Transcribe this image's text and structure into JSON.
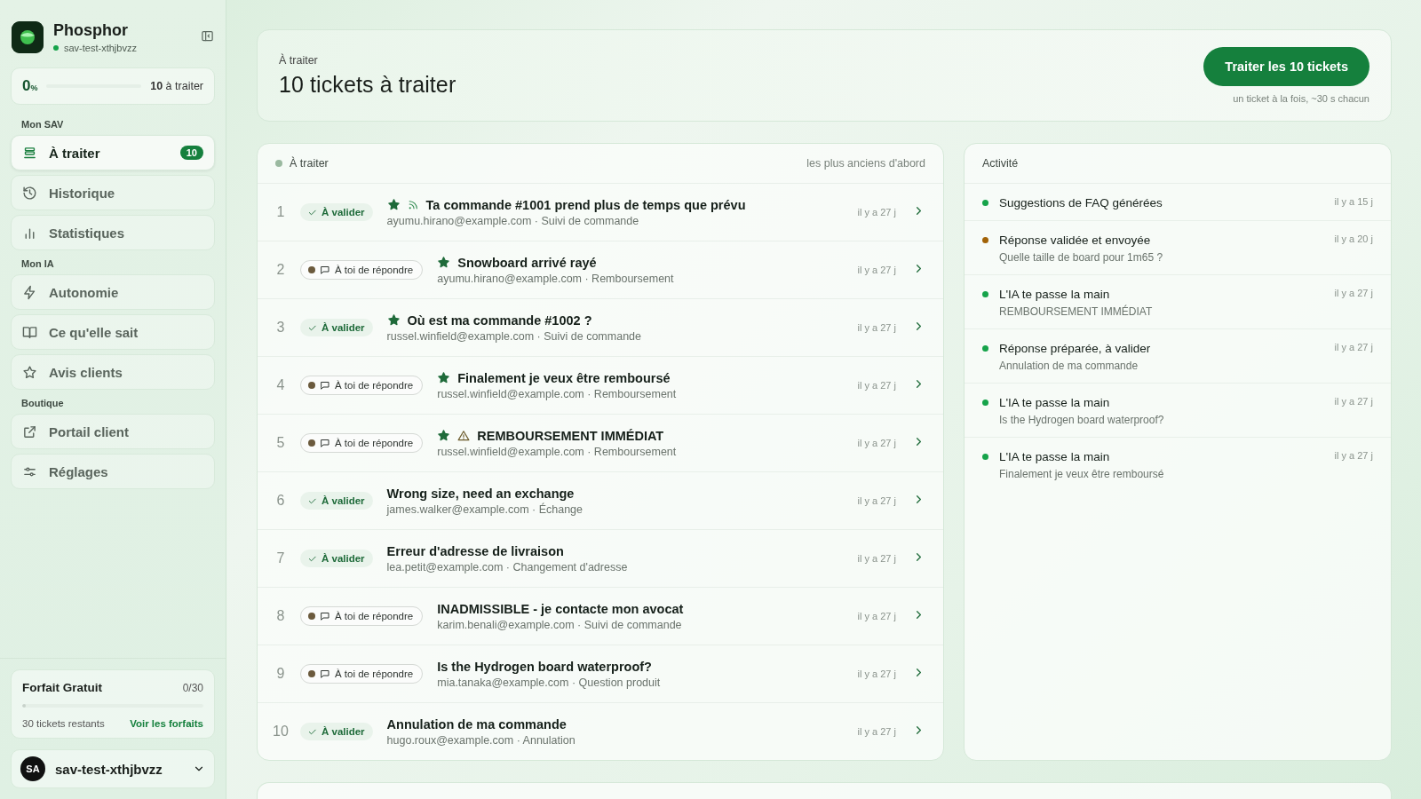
{
  "sidebar": {
    "brand": "Phosphor",
    "workspace": "sav-test-xthjbvzz",
    "progress": {
      "percent": "0",
      "unit": "%",
      "level": 0,
      "count": "10",
      "count_label": "à traiter"
    },
    "sections": [
      {
        "title": "Mon SAV",
        "items": [
          {
            "label": "À traiter",
            "badge": "10",
            "selected": true
          },
          {
            "label": "Historique",
            "selected": false
          },
          {
            "label": "Statistiques",
            "selected": false
          }
        ]
      },
      {
        "title": "Mon IA",
        "items": [
          {
            "label": "Autonomie",
            "selected": false
          },
          {
            "label": "Ce qu'elle sait",
            "selected": false
          },
          {
            "label": "Avis clients",
            "selected": false
          }
        ]
      },
      {
        "title": "Boutique",
        "items": [
          {
            "label": "Portail client",
            "selected": false
          },
          {
            "label": "Réglages",
            "selected": false
          }
        ]
      }
    ],
    "plan": {
      "name": "Forfait Gratuit",
      "usage": "0/30",
      "level": 0,
      "remaining": "30 tickets restants",
      "link": "Voir les forfaits"
    },
    "user": {
      "initials": "SA",
      "name": "sav-test-xthjbvzz"
    }
  },
  "header": {
    "eyebrow": "À traiter",
    "title": "10 tickets à traiter",
    "button": "Traiter les 10 tickets",
    "hint": "un ticket à la fois, ~30 s chacun"
  },
  "queue": {
    "title": "À traiter",
    "sort": "les plus anciens d'abord",
    "tickets": [
      {
        "number": "1",
        "kind": "validate",
        "status": "À valider",
        "starred": true,
        "feed": true,
        "warning": false,
        "subject": "Ta commande #1001 prend plus de temps que prévu",
        "meta": "ayumu.hirano@example.com · Suivi de commande",
        "age": "il y a 27 j"
      },
      {
        "number": "2",
        "kind": "reply",
        "status": "À toi de répondre",
        "starred": true,
        "feed": false,
        "warning": false,
        "subject": "Snowboard arrivé rayé",
        "meta": "ayumu.hirano@example.com · Remboursement",
        "age": "il y a 27 j"
      },
      {
        "number": "3",
        "kind": "validate",
        "status": "À valider",
        "starred": true,
        "feed": false,
        "warning": false,
        "subject": "Où est ma commande #1002 ?",
        "meta": "russel.winfield@example.com · Suivi de commande",
        "age": "il y a 27 j"
      },
      {
        "number": "4",
        "kind": "reply",
        "status": "À toi de répondre",
        "starred": true,
        "feed": false,
        "warning": false,
        "subject": "Finalement je veux être remboursé",
        "meta": "russel.winfield@example.com · Remboursement",
        "age": "il y a 27 j"
      },
      {
        "number": "5",
        "kind": "reply",
        "status": "À toi de répondre",
        "starred": true,
        "feed": false,
        "warning": true,
        "subject": "REMBOURSEMENT IMMÉDIAT",
        "meta": "russel.winfield@example.com · Remboursement",
        "age": "il y a 27 j"
      },
      {
        "number": "6",
        "kind": "validate",
        "status": "À valider",
        "starred": false,
        "feed": false,
        "warning": false,
        "subject": "Wrong size, need an exchange",
        "meta": "james.walker@example.com · Échange",
        "age": "il y a 27 j"
      },
      {
        "number": "7",
        "kind": "validate",
        "status": "À valider",
        "starred": false,
        "feed": false,
        "warning": false,
        "subject": "Erreur d'adresse de livraison",
        "meta": "lea.petit@example.com · Changement d'adresse",
        "age": "il y a 27 j"
      },
      {
        "number": "8",
        "kind": "reply",
        "status": "À toi de répondre",
        "starred": false,
        "feed": false,
        "warning": false,
        "subject": "INADMISSIBLE - je contacte mon avocat",
        "meta": "karim.benali@example.com · Suivi de commande",
        "age": "il y a 27 j"
      },
      {
        "number": "9",
        "kind": "reply",
        "status": "À toi de répondre",
        "starred": false,
        "feed": false,
        "warning": false,
        "subject": "Is the Hydrogen board waterproof?",
        "meta": "mia.tanaka@example.com · Question produit",
        "age": "il y a 27 j"
      },
      {
        "number": "10",
        "kind": "validate",
        "status": "À valider",
        "starred": false,
        "feed": false,
        "warning": false,
        "subject": "Annulation de ma commande",
        "meta": "hugo.roux@example.com · Annulation",
        "age": "il y a 27 j"
      }
    ]
  },
  "activity": {
    "title": "Activité",
    "events": [
      {
        "color": "#16a34a",
        "title": "Suggestions de FAQ générées",
        "age": "il y a 15 j"
      },
      {
        "color": "#a16207",
        "title": "Réponse validée et envoyée",
        "detail": "Quelle taille de board pour 1m65 ?",
        "age": "il y a 20 j"
      },
      {
        "color": "#16a34a",
        "title": "L'IA te passe la main",
        "detail": "REMBOURSEMENT IMMÉDIAT",
        "age": "il y a 27 j"
      },
      {
        "color": "#16a34a",
        "title": "Réponse préparée, à valider",
        "detail": "Annulation de ma commande",
        "age": "il y a 27 j"
      },
      {
        "color": "#16a34a",
        "title": "L'IA te passe la main",
        "detail": "Is the Hydrogen board waterproof?",
        "age": "il y a 27 j"
      },
      {
        "color": "#16a34a",
        "title": "L'IA te passe la main",
        "detail": "Finalement je veux être remboursé",
        "age": "il y a 27 j"
      }
    ]
  }
}
